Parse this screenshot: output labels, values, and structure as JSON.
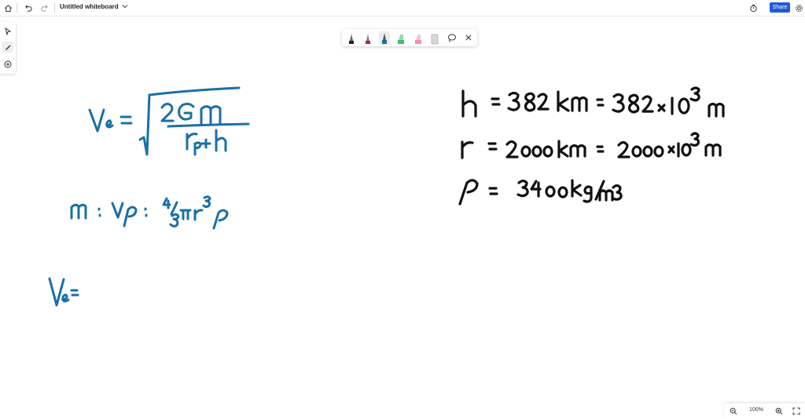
{
  "app": {
    "title": "Untitled whiteboard",
    "share_label": "Share",
    "accent_color": "#1e5bd8"
  },
  "toolbar": {
    "icons": [
      "home-icon",
      "undo-icon",
      "redo-icon",
      "timer-icon",
      "settings-icon",
      "chevron-down-icon"
    ]
  },
  "left_tools": [
    "select-icon",
    "pen-icon",
    "add-icon"
  ],
  "pen_palette": {
    "pens": [
      {
        "name": "black-pen",
        "color": "#222222"
      },
      {
        "name": "magenta-pen",
        "color": "#c2185b"
      },
      {
        "name": "blue-pen",
        "color": "#1a6fa5",
        "selected": true
      },
      {
        "name": "green-highlighter",
        "color": "#3cc06e"
      },
      {
        "name": "pink-highlighter",
        "color": "#f48fb1"
      },
      {
        "name": "eraser",
        "color": "#bdbdbd"
      }
    ],
    "icons": [
      "lasso-icon",
      "close-icon"
    ]
  },
  "zoom": {
    "level": "100%",
    "icons": [
      "zoom-out-icon",
      "zoom-in-icon",
      "fit-icon"
    ]
  }
}
